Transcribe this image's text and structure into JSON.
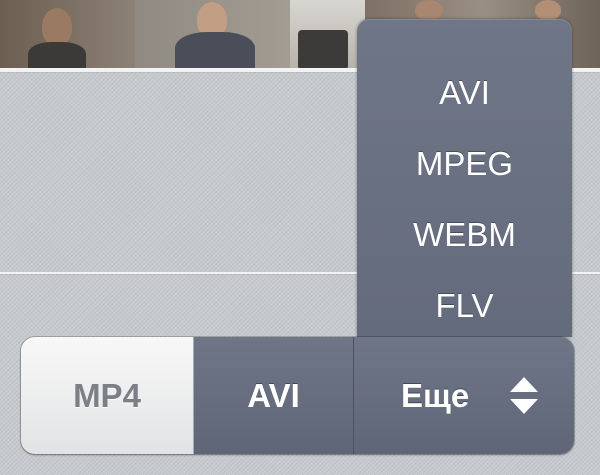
{
  "format_menu": {
    "options": [
      "AVI",
      "MPEG",
      "WEBM",
      "FLV"
    ]
  },
  "format_selector": {
    "segments": [
      {
        "label": "MP4",
        "state": "unselected"
      },
      {
        "label": "AVI",
        "state": "selected"
      },
      {
        "label": "Еще",
        "state": "menu-trigger"
      }
    ],
    "more_icon": "up-down-chevron-icon"
  },
  "colors": {
    "menu_background": "#666d7e",
    "selected_segment": "#666d7e",
    "unselected_segment": "#ececed",
    "page_background": "#c6cace"
  }
}
